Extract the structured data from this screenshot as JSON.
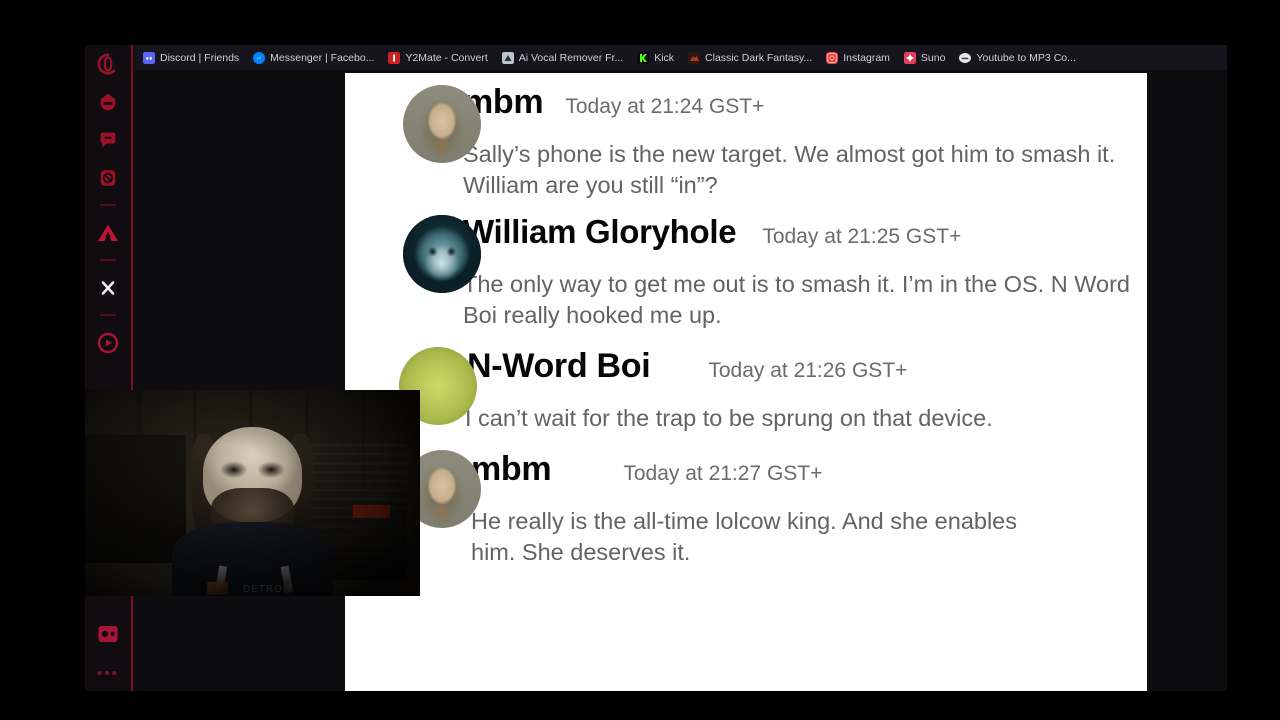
{
  "browser": {
    "sidebar": {
      "icons": [
        {
          "name": "opera-gx-logo-icon",
          "glyph": "gx"
        },
        {
          "name": "gx-corner-icon",
          "glyph": "hat"
        },
        {
          "name": "messenger-icon",
          "glyph": "chat"
        },
        {
          "name": "whatsapp-icon",
          "glyph": "phone"
        },
        {
          "name": "crunchyroll-icon",
          "glyph": "caret"
        },
        {
          "name": "x-twitter-icon",
          "glyph": "X"
        },
        {
          "name": "youtube-icon",
          "glyph": "play"
        }
      ],
      "bottom_icon": {
        "name": "player-icon",
        "glyph": "media"
      },
      "more_label": "•••"
    },
    "bookmarks": [
      {
        "label": "Discord | Friends",
        "favicon_color": "#5865F2",
        "favicon_accent": "#d23b3b"
      },
      {
        "label": "Messenger | Facebo...",
        "favicon_color": "#0084FF",
        "favicon_accent": "#ffffff"
      },
      {
        "label": "Y2Mate - Convert",
        "favicon_color": "#cc2127",
        "favicon_accent": "#ffffff"
      },
      {
        "label": "Ai Vocal Remover Fr...",
        "favicon_color": "#b9c4d0",
        "favicon_accent": "#2a2f38"
      },
      {
        "label": "Kick",
        "favicon_color": "#53fc18",
        "favicon_accent": "#0b0b0b"
      },
      {
        "label": "Classic Dark Fantasy...",
        "favicon_color": "#b13a1f",
        "favicon_accent": "#f0d8b0"
      },
      {
        "label": "Instagram",
        "favicon_color": "#e1306c",
        "favicon_accent": "#fdbb5c"
      },
      {
        "label": "Suno",
        "favicon_color": "#e43b5a",
        "favicon_accent": "#ffffff"
      },
      {
        "label": "Youtube to MP3 Co...",
        "favicon_color": "#e8e8e8",
        "favicon_accent": "#4a4a4a"
      }
    ]
  },
  "chat": {
    "messages": [
      {
        "author": "mbm",
        "timestamp": "Today at 21:24 GST+",
        "text": "Sally’s phone is the new target. We almost got him to smash it. William are you still “in”?",
        "avatar": "avatar-face-photo"
      },
      {
        "author": "William Gloryhole",
        "timestamp": "Today at 21:25 GST+",
        "text": "The only way to get me out is to smash it. I’m in the OS. N Word Boi really hooked me up.",
        "avatar": "avatar-cat-photo"
      },
      {
        "author": "N-Word Boi",
        "timestamp": "Today at 21:26 GST+",
        "text": "I can’t wait for the trap to be sprung on that device.",
        "avatar": "avatar-green-circle"
      },
      {
        "author": "mbm",
        "timestamp": "Today at 21:27 GST+",
        "text": "He really is the all-time lolcow king. And she enables him. She deserves it.",
        "avatar": "avatar-face-photo"
      }
    ]
  },
  "webcam": {
    "label": "webcam-overlay",
    "shirt_text": "DETROIT"
  },
  "colors": {
    "accent_red": "#8c1028",
    "sidebar_bg": "#100c10",
    "bookmarks_bg": "#16141c",
    "page_bg": "#ffffff",
    "author_text": "#060606",
    "body_text": "#636363",
    "time_text": "#6b6b6b"
  }
}
